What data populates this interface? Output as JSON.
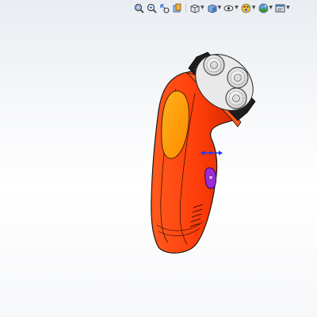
{
  "viewport": {
    "background_top": "#e9edf2",
    "background_bottom": "#ffffff"
  },
  "heads_up_toolbar": {
    "items": [
      {
        "id": "zoom-to-fit",
        "icon": "zoom-to-fit-icon"
      },
      {
        "id": "zoom-to-area",
        "icon": "zoom-to-area-icon"
      },
      {
        "id": "previous-view",
        "icon": "previous-view-icon"
      },
      {
        "id": "section-view",
        "icon": "section-view-icon"
      },
      {
        "id": "view-orientation",
        "icon": "view-orientation-icon",
        "dropdown": true
      },
      {
        "id": "display-style",
        "icon": "display-style-icon",
        "dropdown": true
      },
      {
        "id": "hide-show-items",
        "icon": "hide-show-items-icon",
        "dropdown": true
      },
      {
        "id": "edit-appearance",
        "icon": "edit-appearance-icon",
        "dropdown": true
      },
      {
        "id": "apply-scene",
        "icon": "apply-scene-icon",
        "dropdown": true
      },
      {
        "id": "view-settings",
        "icon": "view-settings-icon",
        "dropdown": true
      }
    ]
  },
  "model": {
    "body_color": "#ff3d0a",
    "body_shade": "#e02a00",
    "grip_color": "#ff9a00",
    "head_ring_color": "#1e1e1e",
    "head_band_color": "#ff5a1a",
    "cutter_color": "#f1f1f1",
    "button_color": "#9b2bd6",
    "triad_color": "#1a3cff"
  }
}
